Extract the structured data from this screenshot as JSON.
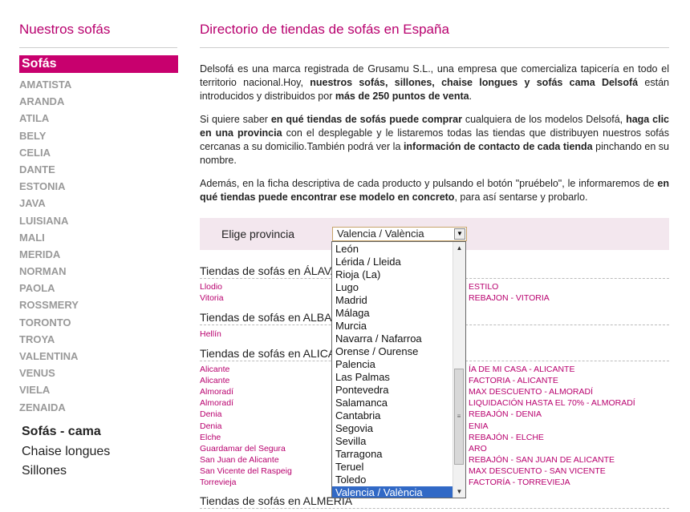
{
  "sidebar": {
    "title": "Nuestros sofás",
    "active": "Sofás",
    "models": [
      "AMATISTA",
      "ARANDA",
      "ATILA",
      "BELY",
      "CELIA",
      "DANTE",
      "ESTONIA",
      "JAVA",
      "LUISIANA",
      "MALI",
      "MERIDA",
      "NORMAN",
      "PAOLA",
      "ROSSMERY",
      "TORONTO",
      "TROYA",
      "VALENTINA",
      "VENUS",
      "VIELA",
      "ZENAIDA"
    ],
    "categories": [
      "Sofás - cama",
      "Chaise longues",
      "Sillones"
    ]
  },
  "main": {
    "title": "Directorio de tiendas de sofás en España",
    "p1": "Delsofá es una marca registrada de Grusamu S.L., una empresa que comercializa tapicería en todo el territorio nacional.Hoy, nuestros sofás, sillones, chaise longues y sofás cama Delsofá están introducidos y distribuidos por más de 250 puntos de venta.",
    "p2": "Si quiere saber en qué tiendas de sofás puede comprar cualquiera de los modelos Delsofá, haga clic en una provincia con el desplegable y le listaremos todas las tiendas que distribuyen nuestros sofás cercanas a su domicilio.También podrá ver la información de contacto de cada tienda pinchando en su nombre.",
    "p3": "Además, en la ficha descriptiva de cada producto y pulsando el botón \"pruébelo\", le informaremos de en qué tiendas puede encontrar ese modelo en concreto, para así sentarse y probarlo.",
    "province_label": "Elige provincia",
    "province_selected": "Valencia / València"
  },
  "sections": {
    "alava": {
      "title": "Tiendas de sofás en ÁLAVA",
      "cities": [
        "Llodio",
        "Vitoria"
      ],
      "shops": [
        "ESTILO",
        "REBAJON - VITORIA"
      ]
    },
    "albacete": {
      "title": "Tiendas de sofás en ALBACETE",
      "cities": [
        "Hellín"
      ]
    },
    "alicante": {
      "title": "Tiendas de sofás en ALICANTE",
      "cities": [
        "Alicante",
        "Alicante",
        "Almoradí",
        "Almoradí",
        "Denia",
        "Denia",
        "Elche",
        "Guardamar del Segura",
        "San Juan de Alicante",
        "San Vicente del Raspeig",
        "Torrevieja"
      ],
      "shops": [
        "ÍA DE MI CASA - ALICANTE",
        "FACTORIA - ALICANTE",
        "MAX DESCUENTO - ALMORADÍ",
        "LIQUIDACIÓN HASTA EL 70% - ALMORADÍ",
        "REBAJÓN - DENIA",
        "ENIA",
        "REBAJÓN - ELCHE",
        "ARO",
        "REBAJÓN - SAN JUAN DE ALICANTE",
        "MAX DESCUENTO - SAN VICENTE",
        "FACTORÍA - TORREVIEJA"
      ]
    },
    "almeria": {
      "title": "Tiendas de sofás en ALMERÍA"
    }
  },
  "dropdown": {
    "options": [
      "León",
      "Lérida / Lleida",
      "Rioja (La)",
      "Lugo",
      "Madrid",
      "Málaga",
      "Murcia",
      "Navarra / Nafarroa",
      "Orense / Ourense",
      "Palencia",
      "Las Palmas",
      "Pontevedra",
      "Salamanca",
      "Cantabria",
      "Segovia",
      "Sevilla",
      "Tarragona",
      "Teruel",
      "Toledo",
      "Valencia / València"
    ],
    "selected_index": 19
  }
}
